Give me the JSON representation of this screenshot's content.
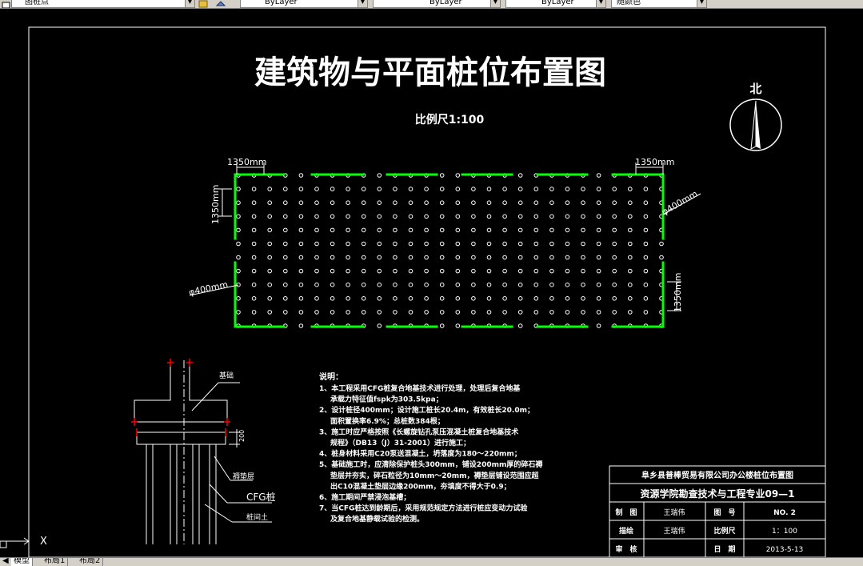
{
  "toolbar": {
    "layer_value": "图桩点",
    "color_value": "ByLayer",
    "linetype_value": "ByLayer",
    "lineweight_value": "ByLayer",
    "plotstyle_value": "随颜色"
  },
  "drawing": {
    "title": "建筑物与平面桩位布置图",
    "scale": "比例尺1:100",
    "north": "北",
    "dim_top_left": "1350mm",
    "dim_top_right": "1350mm",
    "dim_left_vertical": "1350mm",
    "dim_right_vertical": "1350mm",
    "pile_dia_right": "φ400mm",
    "pile_dia_left": "φ400mm",
    "section": {
      "label_foundation": "基础",
      "label_cushion": "褥垫层",
      "label_cfg": "CFG桩",
      "label_soil": "桩间土",
      "dim_value": "200"
    },
    "notes_title": "说明：",
    "notes": [
      "1、本工程采用CFG桩复合地基技术进行处理，处理后复合地基",
      "承载力特征值fspk为303.5kpa；",
      "2、设计桩径400mm；设计施工桩长20.4m，有效桩长20.0m；",
      "面积置换率6.9%；总桩数384根；",
      "3、施工时应严格按照《长螺旋钻孔泵压混凝土桩复合地基技术",
      "规程》（DB13（J）31-2001）进行施工；",
      "4、桩身材料采用C20泵送混凝土，坍落度为180～220mm；",
      "5、基础施工时，应清除保护桩头300mm，铺设200mm厚的碎石褥",
      "垫层并夯实，碎石粒径为10mm～20mm，褥垫层铺设范围应超",
      "出C10混凝土垫层边缘200mm，夯填度不得大于0.9；",
      "6、施工期间严禁浸泡基槽；",
      "7、当CFG桩达到龄期后，采用规范规定方法进行桩应变动力试验",
      "及复合地基静载试验的检测。"
    ],
    "ucs_x": "X",
    "title_block": {
      "project": "阜乡县普棒贸易有限公司办公楼桩位布置图",
      "school": "资源学院勘查技术与工程专业09—1",
      "draw_label": "制　图",
      "draw_name": "王瑞伟",
      "fig_label": "图　号",
      "fig_value": "NO. 2",
      "design_label": "描绘",
      "design_name": "王瑞伟",
      "scale_label": "比例尺",
      "scale_value": "1：100",
      "check_label": "审　核",
      "check_name": "",
      "date_label": "日　期",
      "date_value": "2013-5-13"
    }
  },
  "layout_tabs": [
    "模型",
    "布局1",
    "布局2"
  ],
  "colors": {
    "background": "#000000",
    "pile_outline": "#00ff00",
    "pile_grid": "#ffffff",
    "marker": "#ff0000",
    "toolbar": "#d4d0c8"
  }
}
